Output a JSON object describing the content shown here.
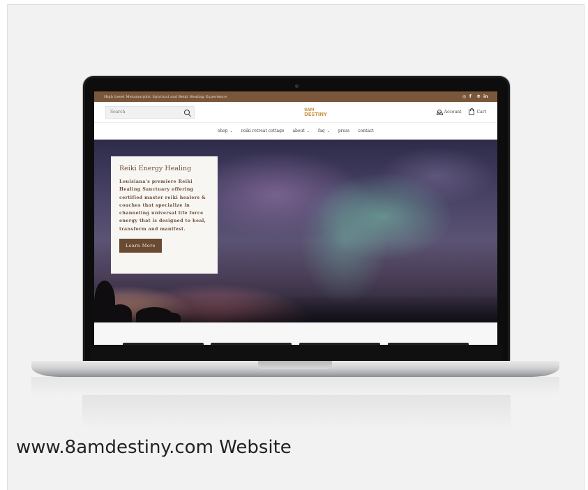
{
  "caption": "www.8amdestiny.com Website",
  "website": {
    "announcement": "High Level Metamorphic Spiritual and Reiki Healing Experience",
    "social_icons": [
      "instagram-icon",
      "facebook-icon",
      "pinterest-icon",
      "linkedin-icon"
    ],
    "search": {
      "placeholder": "Search"
    },
    "logo": {
      "line1": "8AM",
      "line2": "DESTINY"
    },
    "account_label": "Account",
    "cart_label": "Cart",
    "nav": [
      {
        "label": "shop",
        "dropdown": true
      },
      {
        "label": "reiki retreat cottage",
        "dropdown": false
      },
      {
        "label": "about",
        "dropdown": true
      },
      {
        "label": "faq",
        "dropdown": true
      },
      {
        "label": "press",
        "dropdown": false
      },
      {
        "label": "contact",
        "dropdown": false
      }
    ],
    "hero": {
      "title": "Reiki Energy Healing",
      "text": "Louisiana's premiere Reiki Healing Sanctuary offering certified master reiki healers & coaches that specialize in channeling universal life force energy that is designed to heal, transform and manifest.",
      "button": "Learn More"
    }
  },
  "colors": {
    "brand_brown": "#7a573a",
    "button_brown": "#6a4a32",
    "logo_gold": "#c89a4e"
  }
}
